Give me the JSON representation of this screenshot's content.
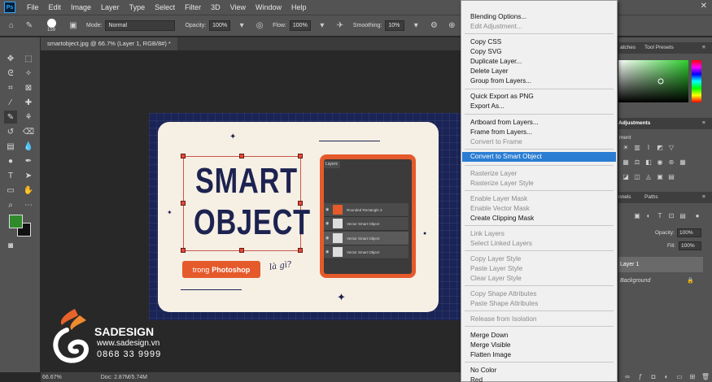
{
  "app": {
    "logo": "Ps"
  },
  "menubar": {
    "items": [
      "File",
      "Edit",
      "Image",
      "Layer",
      "Type",
      "Select",
      "Filter",
      "3D",
      "View",
      "Window",
      "Help"
    ]
  },
  "options_bar": {
    "brush_size": "159",
    "mode_label": "Mode:",
    "mode_value": "Normal",
    "opacity_label": "Opacity:",
    "opacity_value": "100%",
    "flow_label": "Flow:",
    "flow_value": "100%",
    "smoothing_label": "Smoothing:",
    "smoothing_value": "10%"
  },
  "document": {
    "tab_title": "smartobject.jpg @ 66.7% (Layer 1, RGB/8#) *"
  },
  "artwork": {
    "title_line1": "SMART",
    "title_line2": "OBJECT",
    "pill_text_1": "trong",
    "pill_text_2": "Photoshop",
    "la_gi": "là gì?",
    "mini_panel_tab": "Layers",
    "mini_layers": [
      "Rounded Rectangle 3",
      "Vector Smart Object",
      "Vector Smart Object",
      "Vector Smart Object"
    ]
  },
  "watermark": {
    "name": "SADESIGN",
    "site": "www.sadesign.vn",
    "phone": "0868 33 9999"
  },
  "status": {
    "zoom": "66.67%",
    "doc": "Doc: 2.87M/5.74M"
  },
  "right_panels": {
    "tab_swatches": "atches",
    "tab_tool_presets": "Tool Presets",
    "tab_adjustments": "Adjustments",
    "adjustments_label": "ment",
    "tab_channels": "nnels",
    "tab_paths": "Paths",
    "opacity_label": "Opacity:",
    "opacity_value": "100%",
    "fill_label": "Fill:",
    "fill_value": "100%",
    "layer1": "Layer 1",
    "background": "Background"
  },
  "context_menu": {
    "items": [
      {
        "label": "Blending Options...",
        "disabled": false
      },
      {
        "label": "Edit Adjustment...",
        "disabled": true
      },
      {
        "label": "Copy CSS",
        "disabled": false
      },
      {
        "label": "Copy SVG",
        "disabled": false
      },
      {
        "label": "Duplicate Layer...",
        "disabled": false
      },
      {
        "label": "Delete Layer",
        "disabled": false
      },
      {
        "label": "Group from Layers...",
        "disabled": false
      },
      {
        "label": "Quick Export as PNG",
        "disabled": false
      },
      {
        "label": "Export As...",
        "disabled": false
      },
      {
        "label": "Artboard from Layers...",
        "disabled": false
      },
      {
        "label": "Frame from Layers...",
        "disabled": false
      },
      {
        "label": "Convert to Frame",
        "disabled": true
      },
      {
        "label": "Convert to Smart Object",
        "disabled": false,
        "highlight": true
      },
      {
        "label": "Rasterize Layer",
        "disabled": true
      },
      {
        "label": "Rasterize Layer Style",
        "disabled": true
      },
      {
        "label": "Enable Layer Mask",
        "disabled": true
      },
      {
        "label": "Enable Vector Mask",
        "disabled": true
      },
      {
        "label": "Create Clipping Mask",
        "disabled": false
      },
      {
        "label": "Link Layers",
        "disabled": true
      },
      {
        "label": "Select Linked Layers",
        "disabled": true
      },
      {
        "label": "Copy Layer Style",
        "disabled": true
      },
      {
        "label": "Paste Layer Style",
        "disabled": true
      },
      {
        "label": "Clear Layer Style",
        "disabled": true
      },
      {
        "label": "Copy Shape Attributes",
        "disabled": true
      },
      {
        "label": "Paste Shape Attributes",
        "disabled": true
      },
      {
        "label": "Release from Isolation",
        "disabled": true
      },
      {
        "label": "Merge Down",
        "disabled": false
      },
      {
        "label": "Merge Visible",
        "disabled": false
      },
      {
        "label": "Flatten Image",
        "disabled": false
      },
      {
        "label": "No Color",
        "disabled": false
      },
      {
        "label": "Red",
        "disabled": false
      }
    ]
  },
  "colors": {
    "highlight": "#2a7dd2",
    "foreground": "#2f8a2b",
    "background": "#111111",
    "accent_orange": "#e55a2b",
    "navy": "#1d2350"
  }
}
